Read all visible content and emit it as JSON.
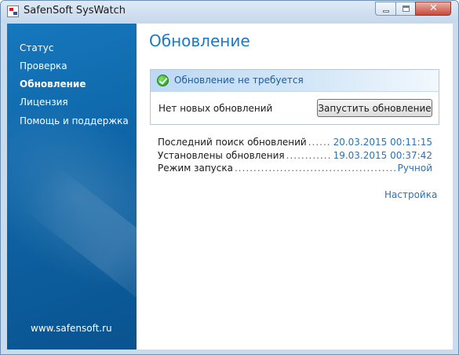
{
  "window": {
    "title": "SafenSoft SysWatch",
    "controls": {
      "minimize": "minimize",
      "maximize": "maximize",
      "close": "✕"
    }
  },
  "sidebar": {
    "items": [
      {
        "label": "Статус",
        "active": false
      },
      {
        "label": "Проверка",
        "active": false
      },
      {
        "label": "Обновление",
        "active": true
      },
      {
        "label": "Лицензия",
        "active": false
      },
      {
        "label": "Помощь и поддержка",
        "active": false
      }
    ],
    "website": "www.safensoft.ru"
  },
  "main": {
    "title": "Обновление",
    "status": {
      "icon": "check-circle-icon",
      "message": "Обновление не требуется"
    },
    "no_updates_text": "Нет новых обновлений",
    "run_update_label": "Запустить обновление",
    "info": [
      {
        "label": "Последний поиск обновлений",
        "value": "20.03.2015 00:11:15"
      },
      {
        "label": "Установлены обновления",
        "value": "19.03.2015 00:37:42"
      },
      {
        "label": "Режим запуска",
        "value": "Ручной"
      }
    ],
    "settings_link": "Настройка"
  },
  "colors": {
    "sidebar_blue": "#0d64a6",
    "title_blue": "#1a78c8",
    "link_blue": "#2a72b8",
    "success_green": "#1f9a1a"
  }
}
